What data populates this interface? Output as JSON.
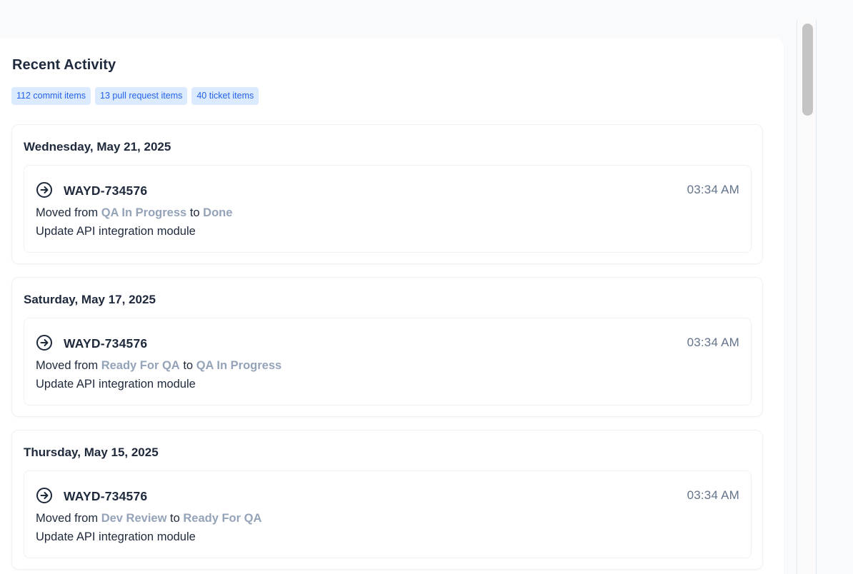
{
  "activity": {
    "title": "Recent Activity",
    "badges": [
      {
        "label": "112 commit items"
      },
      {
        "label": "13 pull request items"
      },
      {
        "label": "40 ticket items"
      }
    ],
    "days": [
      {
        "date": "Wednesday, May 21, 2025",
        "entries": [
          {
            "icon": "arrow-right-circle-icon",
            "id": "WAYD-734576",
            "time": "03:34 AM",
            "moved_prefix": "Moved from",
            "from": "QA In Progress",
            "connector": "to",
            "to": "Done",
            "description": "Update API integration module"
          }
        ]
      },
      {
        "date": "Saturday, May 17, 2025",
        "entries": [
          {
            "icon": "arrow-right-circle-icon",
            "id": "WAYD-734576",
            "time": "03:34 AM",
            "moved_prefix": "Moved from",
            "from": "Ready For QA",
            "connector": "to",
            "to": "QA In Progress",
            "description": "Update API integration module"
          }
        ]
      },
      {
        "date": "Thursday, May 15, 2025",
        "entries": [
          {
            "icon": "arrow-right-circle-icon",
            "id": "WAYD-734576",
            "time": "03:34 AM",
            "moved_prefix": "Moved from",
            "from": "Dev Review",
            "connector": "to",
            "to": "Ready For QA",
            "description": "Update API integration module"
          }
        ]
      }
    ]
  },
  "colors": {
    "background": "#f8fafc",
    "badge_bg": "#dbeafe",
    "badge_text": "#2563eb",
    "status_text": "#94a3b8",
    "heading_text": "#1e293b",
    "time_text": "#64748b"
  }
}
